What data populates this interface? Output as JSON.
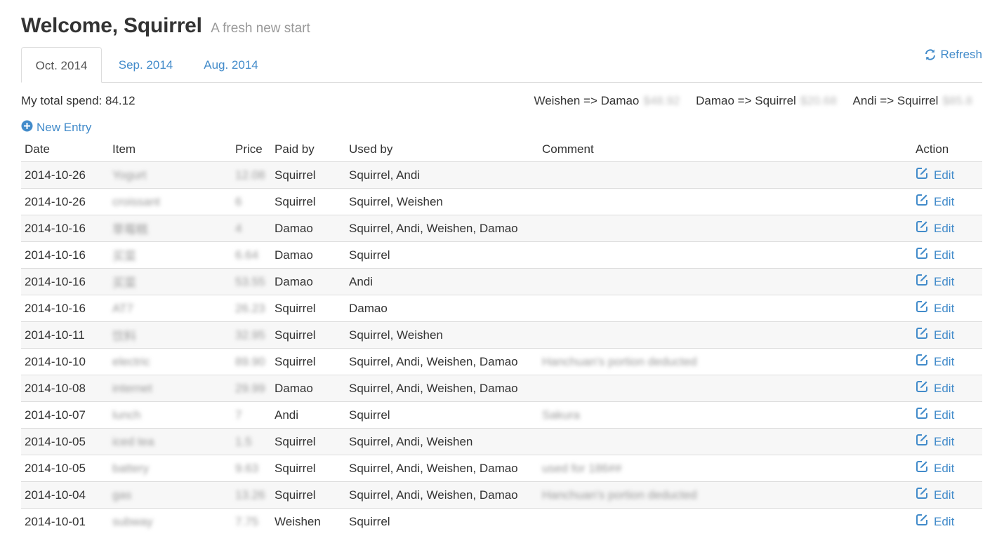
{
  "header": {
    "title": "Welcome, Squirrel",
    "subtitle": "A fresh new start"
  },
  "tabs": [
    {
      "label": "Oct. 2014",
      "active": true
    },
    {
      "label": "Sep. 2014",
      "active": false
    },
    {
      "label": "Aug. 2014",
      "active": false
    }
  ],
  "refresh_label": "Refresh",
  "summary": {
    "total_label": "My total spend: 84.12",
    "balances": [
      {
        "label": "Weishen => Damao",
        "amount": "$48.92"
      },
      {
        "label": "Damao => Squirrel",
        "amount": "$20.68"
      },
      {
        "label": "Andi => Squirrel",
        "amount": "$85.8"
      }
    ]
  },
  "new_entry_label": "New Entry",
  "table": {
    "columns": [
      "Date",
      "Item",
      "Price",
      "Paid by",
      "Used by",
      "Comment",
      "Action"
    ],
    "edit_label": "Edit",
    "rows": [
      {
        "date": "2014-10-26",
        "item": "Yogurt",
        "price": "12.08",
        "paid_by": "Squirrel",
        "used_by": "Squirrel, Andi",
        "comment": ""
      },
      {
        "date": "2014-10-26",
        "item": "croissant",
        "price": "6",
        "paid_by": "Squirrel",
        "used_by": "Squirrel, Weishen",
        "comment": ""
      },
      {
        "date": "2014-10-16",
        "item": "草莓糕",
        "price": "4",
        "paid_by": "Damao",
        "used_by": "Squirrel, Andi, Weishen, Damao",
        "comment": ""
      },
      {
        "date": "2014-10-16",
        "item": "买菜",
        "price": "6.64",
        "paid_by": "Damao",
        "used_by": "Squirrel",
        "comment": ""
      },
      {
        "date": "2014-10-16",
        "item": "买菜",
        "price": "53.55",
        "paid_by": "Damao",
        "used_by": "Andi",
        "comment": ""
      },
      {
        "date": "2014-10-16",
        "item": "AT7",
        "price": "26.23",
        "paid_by": "Squirrel",
        "used_by": "Damao",
        "comment": ""
      },
      {
        "date": "2014-10-11",
        "item": "饮料",
        "price": "32.95",
        "paid_by": "Squirrel",
        "used_by": "Squirrel, Weishen",
        "comment": ""
      },
      {
        "date": "2014-10-10",
        "item": "electric",
        "price": "89.90",
        "paid_by": "Squirrel",
        "used_by": "Squirrel, Andi, Weishen, Damao",
        "comment": "Hanchuan's portion deducted"
      },
      {
        "date": "2014-10-08",
        "item": "internet",
        "price": "29.99",
        "paid_by": "Damao",
        "used_by": "Squirrel, Andi, Weishen, Damao",
        "comment": ""
      },
      {
        "date": "2014-10-07",
        "item": "lunch",
        "price": "7",
        "paid_by": "Andi",
        "used_by": "Squirrel",
        "comment": "Sakura"
      },
      {
        "date": "2014-10-05",
        "item": "iced tea",
        "price": "1.5",
        "paid_by": "Squirrel",
        "used_by": "Squirrel, Andi, Weishen",
        "comment": ""
      },
      {
        "date": "2014-10-05",
        "item": "battery",
        "price": "9.63",
        "paid_by": "Squirrel",
        "used_by": "Squirrel, Andi, Weishen, Damao",
        "comment": "used for 186##"
      },
      {
        "date": "2014-10-04",
        "item": "gas",
        "price": "13.26",
        "paid_by": "Squirrel",
        "used_by": "Squirrel, Andi, Weishen, Damao",
        "comment": "Hanchuan's portion deducted"
      },
      {
        "date": "2014-10-01",
        "item": "subway",
        "price": "7.75",
        "paid_by": "Weishen",
        "used_by": "Squirrel",
        "comment": ""
      }
    ]
  }
}
